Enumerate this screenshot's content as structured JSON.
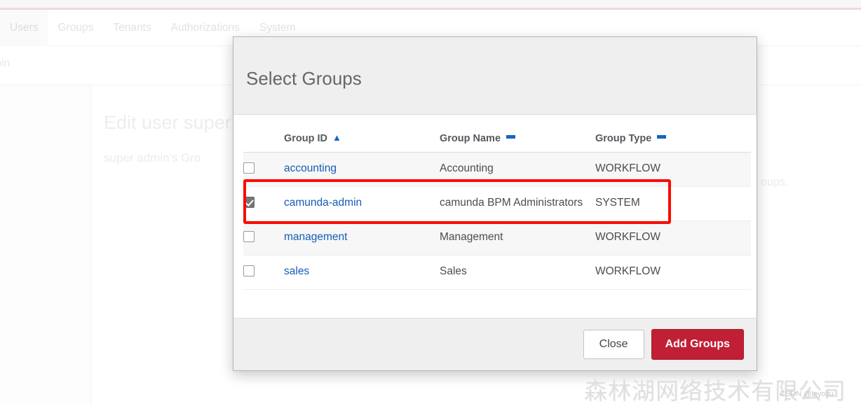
{
  "app": {
    "nav_tabs": [
      {
        "label": "Users",
        "active": true
      },
      {
        "label": "Groups",
        "active": false
      },
      {
        "label": "Tenants",
        "active": false
      },
      {
        "label": "Authorizations",
        "active": false
      },
      {
        "label": "System",
        "active": false
      }
    ],
    "breadcrumb": "admin",
    "page_heading": "Edit user super",
    "page_subtitle": "super admin's Gro",
    "page_subtitle_right": "oups."
  },
  "modal": {
    "title": "Select Groups",
    "table": {
      "headers": [
        {
          "label": "",
          "sort": "none"
        },
        {
          "label": "Group ID",
          "sort": "asc"
        },
        {
          "label": "Group Name",
          "sort": "flat"
        },
        {
          "label": "Group Type",
          "sort": "flat"
        }
      ],
      "rows": [
        {
          "checked": false,
          "group_id": "accounting",
          "group_name": "Accounting",
          "group_type": "WORKFLOW",
          "striped": true,
          "highlighted": false
        },
        {
          "checked": true,
          "group_id": "camunda-admin",
          "group_name": "camunda BPM Administrators",
          "group_type": "SYSTEM",
          "striped": false,
          "highlighted": true
        },
        {
          "checked": false,
          "group_id": "management",
          "group_name": "Management",
          "group_type": "WORKFLOW",
          "striped": true,
          "highlighted": false
        },
        {
          "checked": false,
          "group_id": "sales",
          "group_name": "Sales",
          "group_type": "WORKFLOW",
          "striped": false,
          "highlighted": false
        }
      ]
    },
    "footer": {
      "close_label": "Close",
      "add_label": "Add Groups"
    }
  },
  "annotation": {
    "color": "#fb0b04"
  },
  "watermark": {
    "text": "森林湖网络技术有限公司",
    "credit": "CSDN @leyoliu"
  },
  "colors": {
    "accent_red": "#c01f35",
    "link_blue": "#155cb5",
    "sort_blue": "#1565c0",
    "header_gray": "#efefef"
  }
}
